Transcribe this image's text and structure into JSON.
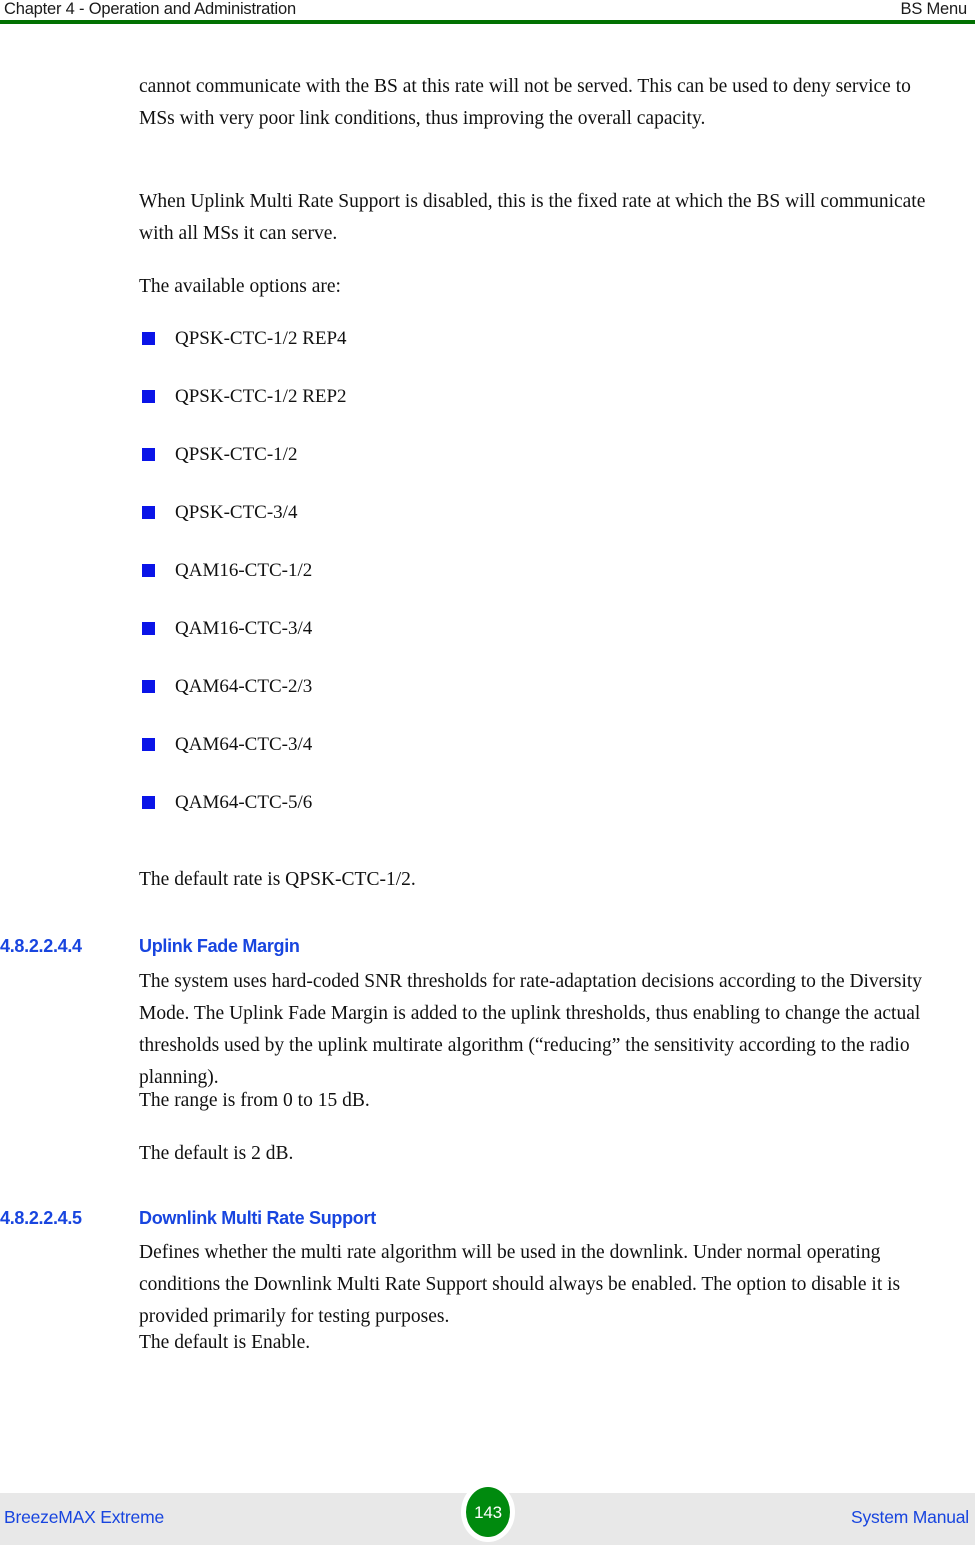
{
  "header": {
    "left": "Chapter 4 - Operation and Administration",
    "right": "BS Menu",
    "rule_color": "#027102"
  },
  "body": {
    "paragraphs": {
      "p1": "cannot communicate with the BS at this rate will not be served. This can be used to deny service to MSs with very poor link conditions, thus improving the overall capacity.",
      "p2": "When Uplink Multi Rate Support is disabled, this is the fixed rate at which the BS will communicate with all MSs it can serve.",
      "p3": "The available options are:",
      "p4": "The default rate is QPSK-CTC-1/2.",
      "p5": "The system uses hard-coded SNR thresholds for rate-adaptation decisions according to the Diversity Mode. The Uplink Fade Margin is added to the uplink thresholds, thus enabling to change the actual thresholds used by the uplink multirate algorithm (“reducing” the sensitivity according to the radio planning).",
      "p6": "The range is from 0 to 15 dB.",
      "p7": "The default is 2 dB.",
      "p8": "Defines whether the multi rate algorithm will be used in the downlink. Under normal operating conditions the Downlink Multi Rate Support should always be enabled. The option to disable it is provided primarily for testing purposes.",
      "p9": "The default is Enable."
    },
    "rate_options": [
      "QPSK-CTC-1/2 REP4",
      "QPSK-CTC-1/2 REP2",
      "QPSK-CTC-1/2",
      "QPSK-CTC-3/4",
      "QAM16-CTC-1/2",
      "QAM16-CTC-3/4",
      "QAM64-CTC-2/3",
      "QAM64-CTC-3/4",
      "QAM64-CTC-5/6"
    ],
    "bullet_color": "#0a14e8",
    "sections": [
      {
        "number": "4.8.2.2.4.4",
        "title": "Uplink Fade Margin"
      },
      {
        "number": "4.8.2.2.4.5",
        "title": "Downlink Multi Rate Support"
      }
    ],
    "heading_color": "#1845df"
  },
  "footer": {
    "left": "BreezeMAX Extreme",
    "page_number": "143",
    "right": "System Manual",
    "band_color": "#e8e8e8",
    "badge_color": "#008a0e",
    "text_color": "#1845df"
  }
}
